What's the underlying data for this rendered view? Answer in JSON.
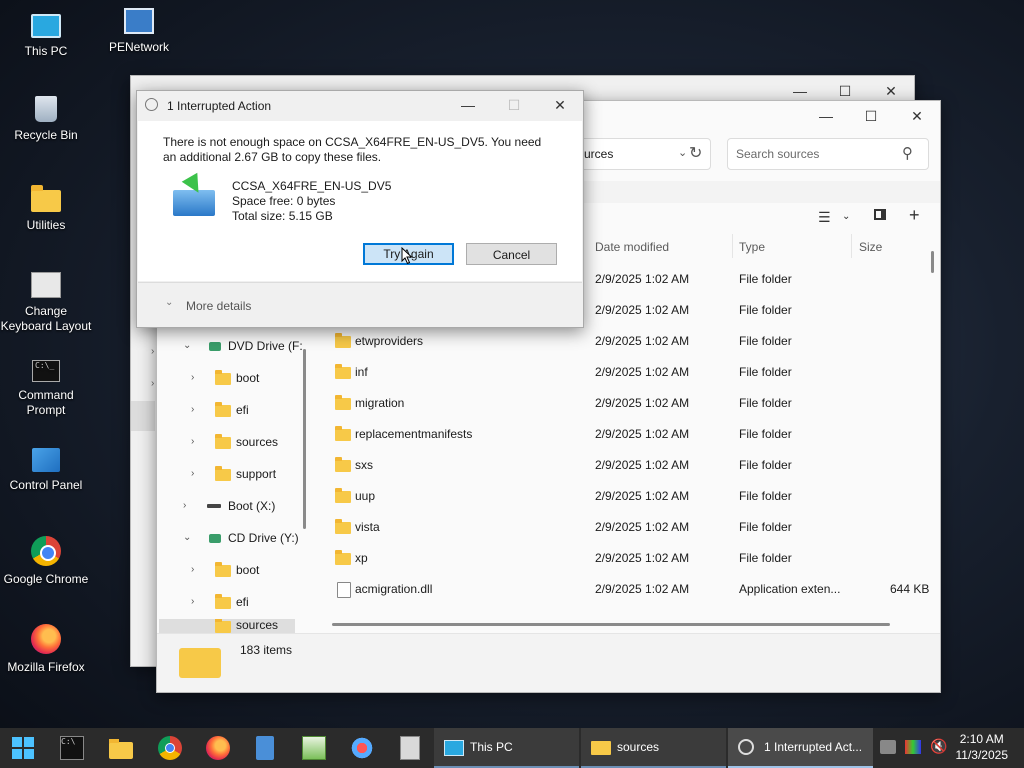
{
  "desktop": {
    "icons": [
      {
        "label": "This PC"
      },
      {
        "label": "PENetwork"
      },
      {
        "label": "Recycle Bin"
      },
      {
        "label": "Utilities"
      },
      {
        "label": "Change Keyboard Layout"
      },
      {
        "label": "Command Prompt"
      },
      {
        "label": "Control Panel"
      },
      {
        "label": "Google Chrome"
      },
      {
        "label": "Mozilla Firefox"
      }
    ]
  },
  "dialog": {
    "title": "1 Interrupted Action",
    "message": "There is not enough space on CCSA_X64FRE_EN-US_DV5. You need an additional 2.67 GB to copy these files.",
    "drive_name": "CCSA_X64FRE_EN-US_DV5",
    "space_free": "Space free: 0 bytes",
    "total_size": "Total size: 5.15 GB",
    "try_again": "Try Again",
    "cancel": "Cancel",
    "more_details": "More details"
  },
  "explorer": {
    "address_partial": "urces",
    "search_placeholder": "Search sources",
    "columns": {
      "date": "Date modified",
      "type": "Type",
      "size": "Size"
    },
    "nav": [
      {
        "label": "DVD Drive (F:",
        "expanded": true
      },
      {
        "label": "boot"
      },
      {
        "label": "efi"
      },
      {
        "label": "sources"
      },
      {
        "label": "support"
      },
      {
        "label": "Boot (X:)"
      },
      {
        "label": "CD Drive (Y:)",
        "expanded": true
      },
      {
        "label": "boot"
      },
      {
        "label": "efi"
      },
      {
        "label": "sources"
      }
    ],
    "rows": [
      {
        "name": "",
        "date": "2/9/2025 1:02 AM",
        "type": "File folder",
        "size": ""
      },
      {
        "name": "",
        "date": "2/9/2025 1:02 AM",
        "type": "File folder",
        "size": ""
      },
      {
        "name": "etwproviders",
        "date": "2/9/2025 1:02 AM",
        "type": "File folder",
        "size": ""
      },
      {
        "name": "inf",
        "date": "2/9/2025 1:02 AM",
        "type": "File folder",
        "size": ""
      },
      {
        "name": "migration",
        "date": "2/9/2025 1:02 AM",
        "type": "File folder",
        "size": ""
      },
      {
        "name": "replacementmanifests",
        "date": "2/9/2025 1:02 AM",
        "type": "File folder",
        "size": ""
      },
      {
        "name": "sxs",
        "date": "2/9/2025 1:02 AM",
        "type": "File folder",
        "size": ""
      },
      {
        "name": "uup",
        "date": "2/9/2025 1:02 AM",
        "type": "File folder",
        "size": ""
      },
      {
        "name": "vista",
        "date": "2/9/2025 1:02 AM",
        "type": "File folder",
        "size": ""
      },
      {
        "name": "xp",
        "date": "2/9/2025 1:02 AM",
        "type": "File folder",
        "size": ""
      },
      {
        "name": "acmigration.dll",
        "date": "2/9/2025 1:02 AM",
        "type": "Application exten...",
        "size": "644 KB"
      }
    ],
    "status": "183 items"
  },
  "taskbar": {
    "tasks": [
      {
        "label": "This PC"
      },
      {
        "label": "sources"
      },
      {
        "label": "1 Interrupted Act..."
      }
    ],
    "time": "2:10 AM",
    "date": "11/3/2025"
  }
}
